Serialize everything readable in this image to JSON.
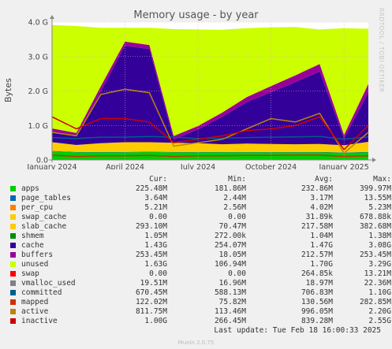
{
  "title": "Memory usage - by year",
  "side_label": "RRDTOOL / TOBI OETIKER",
  "chart_data": {
    "type": "area",
    "title": "Memory usage - by year",
    "ylabel": "Bytes",
    "ylim": [
      0,
      4.0
    ],
    "y_unit": "G",
    "yticks": [
      "0.0",
      "1.0 G",
      "2.0 G",
      "3.0 G",
      "4.0 G"
    ],
    "xticks": [
      "January 2024",
      "April 2024",
      "July 2024",
      "October 2024",
      "January 2025"
    ],
    "grid": true,
    "x_months": [
      0,
      1,
      2,
      3,
      4,
      5,
      6,
      7,
      8,
      9,
      10,
      11,
      12,
      13
    ],
    "series": [
      {
        "name": "apps",
        "values": [
          0.25,
          0.22,
          0.22,
          0.22,
          0.23,
          0.22,
          0.22,
          0.22,
          0.22,
          0.22,
          0.22,
          0.22,
          0.21,
          0.22
        ]
      },
      {
        "name": "page_tables",
        "values": [
          0.01,
          0.01,
          0.01,
          0.01,
          0.01,
          0.01,
          0.01,
          0.01,
          0.01,
          0.01,
          0.01,
          0.01,
          0.01,
          0.01
        ]
      },
      {
        "name": "per_cpu",
        "values": [
          0.005,
          0.005,
          0.005,
          0.005,
          0.005,
          0.005,
          0.005,
          0.005,
          0.005,
          0.005,
          0.005,
          0.005,
          0.005,
          0.005
        ]
      },
      {
        "name": "slab_cache",
        "values": [
          0.25,
          0.2,
          0.25,
          0.28,
          0.27,
          0.26,
          0.25,
          0.22,
          0.24,
          0.23,
          0.22,
          0.23,
          0.2,
          0.29
        ]
      },
      {
        "name": "cache",
        "values": [
          0.3,
          0.25,
          1.5,
          2.8,
          2.7,
          0.1,
          0.4,
          0.8,
          1.2,
          1.5,
          1.8,
          2.1,
          0.2,
          1.43
        ]
      },
      {
        "name": "buffers",
        "values": [
          0.1,
          0.1,
          0.15,
          0.12,
          0.12,
          0.1,
          0.1,
          0.12,
          0.15,
          0.18,
          0.2,
          0.22,
          0.1,
          0.25
        ]
      },
      {
        "name": "unused",
        "values": [
          3.0,
          3.1,
          1.7,
          0.4,
          0.5,
          3.1,
          2.8,
          2.4,
          2.0,
          1.7,
          1.4,
          1.0,
          3.1,
          1.6
        ]
      },
      {
        "name": "committed",
        "values": [
          0.65,
          0.62,
          0.66,
          0.66,
          0.68,
          0.66,
          0.62,
          0.63,
          0.65,
          0.66,
          0.67,
          0.68,
          0.6,
          0.67
        ]
      },
      {
        "name": "mapped",
        "values": [
          0.14,
          0.1,
          0.12,
          0.12,
          0.13,
          0.1,
          0.12,
          0.12,
          0.13,
          0.13,
          0.14,
          0.14,
          0.1,
          0.12
        ]
      },
      {
        "name": "active",
        "values": [
          0.8,
          0.7,
          1.9,
          2.05,
          1.95,
          0.4,
          0.5,
          0.6,
          0.9,
          1.2,
          1.1,
          1.35,
          0.2,
          0.8
        ]
      },
      {
        "name": "inactive",
        "values": [
          1.25,
          0.9,
          1.2,
          1.2,
          1.1,
          0.5,
          0.6,
          0.7,
          0.85,
          0.9,
          1.0,
          1.25,
          0.3,
          1.0
        ]
      }
    ]
  },
  "legend": {
    "headers": {
      "cur": "Cur:",
      "min": "Min:",
      "avg": "Avg:",
      "max": "Max:"
    },
    "rows": [
      {
        "name": "apps",
        "color": "#00cc00",
        "cur": "225.48M",
        "min": "181.86M",
        "avg": "232.86M",
        "max": "399.97M"
      },
      {
        "name": "page_tables",
        "color": "#0066b3",
        "cur": "3.64M",
        "min": "2.44M",
        "avg": "3.17M",
        "max": "13.55M"
      },
      {
        "name": "per_cpu",
        "color": "#ff8000",
        "cur": "5.21M",
        "min": "2.56M",
        "avg": "4.02M",
        "max": "5.23M"
      },
      {
        "name": "swap_cache",
        "color": "#ffcc00",
        "cur": "0.00",
        "min": "0.00",
        "avg": "31.89k",
        "max": "678.88k"
      },
      {
        "name": "slab_cache",
        "color": "#ffcc00",
        "cur": "293.10M",
        "min": "70.47M",
        "avg": "217.58M",
        "max": "382.68M"
      },
      {
        "name": "shmem",
        "color": "#008f00",
        "cur": "1.05M",
        "min": "272.00k",
        "avg": "1.04M",
        "max": "1.38M"
      },
      {
        "name": "cache",
        "color": "#330099",
        "cur": "1.43G",
        "min": "254.07M",
        "avg": "1.47G",
        "max": "3.08G"
      },
      {
        "name": "buffers",
        "color": "#990099",
        "cur": "253.45M",
        "min": "18.05M",
        "avg": "212.57M",
        "max": "253.45M"
      },
      {
        "name": "unused",
        "color": "#ccff00",
        "cur": "1.63G",
        "min": "106.94M",
        "avg": "1.70G",
        "max": "3.29G"
      },
      {
        "name": "swap",
        "color": "#ff0000",
        "cur": "0.00",
        "min": "0.00",
        "avg": "264.85k",
        "max": "13.21M"
      },
      {
        "name": "vmalloc_used",
        "color": "#808080",
        "cur": "19.51M",
        "min": "16.96M",
        "avg": "18.97M",
        "max": "22.36M"
      },
      {
        "name": "committed",
        "color": "#005e8a",
        "cur": "670.45M",
        "min": "588.13M",
        "avg": "706.83M",
        "max": "1.10G"
      },
      {
        "name": "mapped",
        "color": "#cc3300",
        "cur": "122.02M",
        "min": "75.82M",
        "avg": "130.56M",
        "max": "282.85M"
      },
      {
        "name": "active",
        "color": "#b8860b",
        "cur": "811.75M",
        "min": "113.46M",
        "avg": "996.05M",
        "max": "2.20G"
      },
      {
        "name": "inactive",
        "color": "#cc0000",
        "cur": "1.00G",
        "min": "266.45M",
        "avg": "839.28M",
        "max": "2.55G"
      }
    ]
  },
  "last_update": "Last update: Tue Feb 18 16:00:33 2025",
  "footer": "Munin 2.0.75",
  "colors": {
    "apps": "#00cc00",
    "page_tables": "#0066b3",
    "per_cpu": "#ff8000",
    "slab_cache": "#ffcc00",
    "cache": "#330099",
    "buffers": "#990099",
    "unused": "#ccff00",
    "committed": "#005e8a",
    "mapped": "#cc3300",
    "active": "#b8860b",
    "inactive": "#cc0000",
    "grid": "#e0b0b0",
    "axis": "#888888",
    "plot_bg": "#ffffff"
  }
}
